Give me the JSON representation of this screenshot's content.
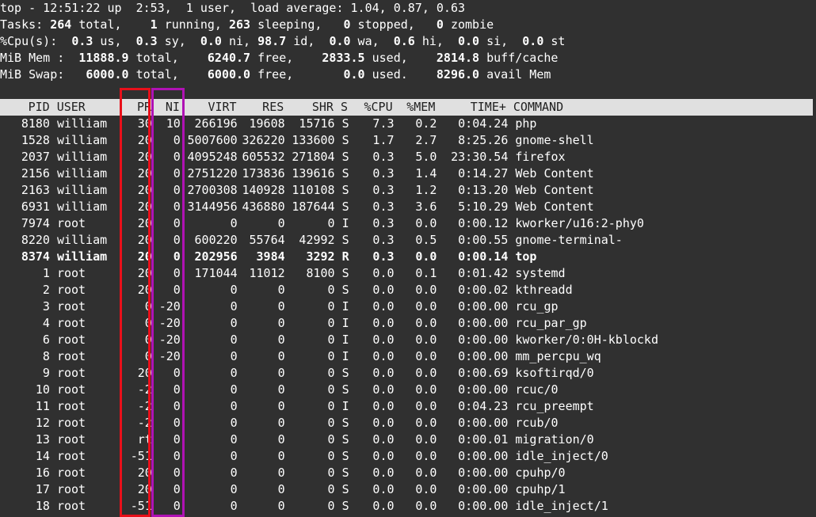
{
  "summary": {
    "line1": "top - 12:51:22 up  2:53,  1 user,  load average: 1.04, 0.87, 0.63",
    "tasks": {
      "label": "Tasks:",
      "total": "264",
      "total_l": " total,",
      "running": "1",
      "running_l": " running,",
      "sleeping": "263",
      "sleeping_l": " sleeping,",
      "stopped": "0",
      "stopped_l": " stopped,",
      "zombie": "0",
      "zombie_l": " zombie"
    },
    "cpu": {
      "label": "%Cpu(s):",
      "us": "0.3",
      "us_l": " us,",
      "sy": "0.3",
      "sy_l": " sy,",
      "ni": "0.0",
      "ni_l": " ni,",
      "id": "98.7",
      "id_l": " id,",
      "wa": "0.0",
      "wa_l": " wa,",
      "hi": "0.6",
      "hi_l": " hi,",
      "si": "0.0",
      "si_l": " si,",
      "st": "0.0",
      "st_l": " st"
    },
    "mem": {
      "label": "MiB Mem :",
      "total": "11888.9",
      "total_l": " total,",
      "free": "6240.7",
      "free_l": " free,",
      "used": "2833.5",
      "used_l": " used,",
      "buff": "2814.8",
      "buff_l": " buff/cache"
    },
    "swap": {
      "label": "MiB Swap:",
      "total": "6000.0",
      "total_l": " total,",
      "free": "6000.0",
      "free_l": " free,",
      "used": "0.0",
      "used_l": " used.",
      "avail": "8296.0",
      "avail_l": " avail Mem"
    }
  },
  "columns": [
    "PID",
    "USER",
    "PR",
    "NI",
    "VIRT",
    "RES",
    "SHR",
    "S",
    "%CPU",
    "%MEM",
    "TIME+",
    "COMMAND"
  ],
  "processes": [
    {
      "pid": "8180",
      "user": "william",
      "pr": "30",
      "ni": "10",
      "virt": "266196",
      "res": "19608",
      "shr": "15716",
      "s": "S",
      "cpu": "7.3",
      "mem": "0.2",
      "time": "0:04.24",
      "cmd": "php",
      "bold": false
    },
    {
      "pid": "1528",
      "user": "william",
      "pr": "20",
      "ni": "0",
      "virt": "5007600",
      "res": "326220",
      "shr": "133600",
      "s": "S",
      "cpu": "1.7",
      "mem": "2.7",
      "time": "8:25.26",
      "cmd": "gnome-shell",
      "bold": false
    },
    {
      "pid": "2037",
      "user": "william",
      "pr": "20",
      "ni": "0",
      "virt": "4095248",
      "res": "605532",
      "shr": "271804",
      "s": "S",
      "cpu": "0.3",
      "mem": "5.0",
      "time": "23:30.54",
      "cmd": "firefox",
      "bold": false
    },
    {
      "pid": "2156",
      "user": "william",
      "pr": "20",
      "ni": "0",
      "virt": "2751220",
      "res": "173836",
      "shr": "139616",
      "s": "S",
      "cpu": "0.3",
      "mem": "1.4",
      "time": "0:14.27",
      "cmd": "Web Content",
      "bold": false
    },
    {
      "pid": "2163",
      "user": "william",
      "pr": "20",
      "ni": "0",
      "virt": "2700308",
      "res": "140928",
      "shr": "110108",
      "s": "S",
      "cpu": "0.3",
      "mem": "1.2",
      "time": "0:13.20",
      "cmd": "Web Content",
      "bold": false
    },
    {
      "pid": "6931",
      "user": "william",
      "pr": "20",
      "ni": "0",
      "virt": "3144956",
      "res": "436880",
      "shr": "187644",
      "s": "S",
      "cpu": "0.3",
      "mem": "3.6",
      "time": "5:10.29",
      "cmd": "Web Content",
      "bold": false
    },
    {
      "pid": "7974",
      "user": "root",
      "pr": "20",
      "ni": "0",
      "virt": "0",
      "res": "0",
      "shr": "0",
      "s": "I",
      "cpu": "0.3",
      "mem": "0.0",
      "time": "0:00.12",
      "cmd": "kworker/u16:2-phy0",
      "bold": false
    },
    {
      "pid": "8220",
      "user": "william",
      "pr": "20",
      "ni": "0",
      "virt": "600220",
      "res": "55764",
      "shr": "42992",
      "s": "S",
      "cpu": "0.3",
      "mem": "0.5",
      "time": "0:00.55",
      "cmd": "gnome-terminal-",
      "bold": false
    },
    {
      "pid": "8374",
      "user": "william",
      "pr": "20",
      "ni": "0",
      "virt": "202956",
      "res": "3984",
      "shr": "3292",
      "s": "R",
      "cpu": "0.3",
      "mem": "0.0",
      "time": "0:00.14",
      "cmd": "top",
      "bold": true
    },
    {
      "pid": "1",
      "user": "root",
      "pr": "20",
      "ni": "0",
      "virt": "171044",
      "res": "11012",
      "shr": "8100",
      "s": "S",
      "cpu": "0.0",
      "mem": "0.1",
      "time": "0:01.42",
      "cmd": "systemd",
      "bold": false
    },
    {
      "pid": "2",
      "user": "root",
      "pr": "20",
      "ni": "0",
      "virt": "0",
      "res": "0",
      "shr": "0",
      "s": "S",
      "cpu": "0.0",
      "mem": "0.0",
      "time": "0:00.02",
      "cmd": "kthreadd",
      "bold": false
    },
    {
      "pid": "3",
      "user": "root",
      "pr": "0",
      "ni": "-20",
      "virt": "0",
      "res": "0",
      "shr": "0",
      "s": "I",
      "cpu": "0.0",
      "mem": "0.0",
      "time": "0:00.00",
      "cmd": "rcu_gp",
      "bold": false
    },
    {
      "pid": "4",
      "user": "root",
      "pr": "0",
      "ni": "-20",
      "virt": "0",
      "res": "0",
      "shr": "0",
      "s": "I",
      "cpu": "0.0",
      "mem": "0.0",
      "time": "0:00.00",
      "cmd": "rcu_par_gp",
      "bold": false
    },
    {
      "pid": "6",
      "user": "root",
      "pr": "0",
      "ni": "-20",
      "virt": "0",
      "res": "0",
      "shr": "0",
      "s": "I",
      "cpu": "0.0",
      "mem": "0.0",
      "time": "0:00.00",
      "cmd": "kworker/0:0H-kblockd",
      "bold": false
    },
    {
      "pid": "8",
      "user": "root",
      "pr": "0",
      "ni": "-20",
      "virt": "0",
      "res": "0",
      "shr": "0",
      "s": "I",
      "cpu": "0.0",
      "mem": "0.0",
      "time": "0:00.00",
      "cmd": "mm_percpu_wq",
      "bold": false
    },
    {
      "pid": "9",
      "user": "root",
      "pr": "20",
      "ni": "0",
      "virt": "0",
      "res": "0",
      "shr": "0",
      "s": "S",
      "cpu": "0.0",
      "mem": "0.0",
      "time": "0:00.69",
      "cmd": "ksoftirqd/0",
      "bold": false
    },
    {
      "pid": "10",
      "user": "root",
      "pr": "-2",
      "ni": "0",
      "virt": "0",
      "res": "0",
      "shr": "0",
      "s": "S",
      "cpu": "0.0",
      "mem": "0.0",
      "time": "0:00.00",
      "cmd": "rcuc/0",
      "bold": false
    },
    {
      "pid": "11",
      "user": "root",
      "pr": "-2",
      "ni": "0",
      "virt": "0",
      "res": "0",
      "shr": "0",
      "s": "I",
      "cpu": "0.0",
      "mem": "0.0",
      "time": "0:04.23",
      "cmd": "rcu_preempt",
      "bold": false
    },
    {
      "pid": "12",
      "user": "root",
      "pr": "-2",
      "ni": "0",
      "virt": "0",
      "res": "0",
      "shr": "0",
      "s": "S",
      "cpu": "0.0",
      "mem": "0.0",
      "time": "0:00.00",
      "cmd": "rcub/0",
      "bold": false
    },
    {
      "pid": "13",
      "user": "root",
      "pr": "rt",
      "ni": "0",
      "virt": "0",
      "res": "0",
      "shr": "0",
      "s": "S",
      "cpu": "0.0",
      "mem": "0.0",
      "time": "0:00.01",
      "cmd": "migration/0",
      "bold": false
    },
    {
      "pid": "14",
      "user": "root",
      "pr": "-51",
      "ni": "0",
      "virt": "0",
      "res": "0",
      "shr": "0",
      "s": "S",
      "cpu": "0.0",
      "mem": "0.0",
      "time": "0:00.00",
      "cmd": "idle_inject/0",
      "bold": false
    },
    {
      "pid": "16",
      "user": "root",
      "pr": "20",
      "ni": "0",
      "virt": "0",
      "res": "0",
      "shr": "0",
      "s": "S",
      "cpu": "0.0",
      "mem": "0.0",
      "time": "0:00.00",
      "cmd": "cpuhp/0",
      "bold": false
    },
    {
      "pid": "17",
      "user": "root",
      "pr": "20",
      "ni": "0",
      "virt": "0",
      "res": "0",
      "shr": "0",
      "s": "S",
      "cpu": "0.0",
      "mem": "0.0",
      "time": "0:00.00",
      "cmd": "cpuhp/1",
      "bold": false
    },
    {
      "pid": "18",
      "user": "root",
      "pr": "-51",
      "ni": "0",
      "virt": "0",
      "res": "0",
      "shr": "0",
      "s": "S",
      "cpu": "0.0",
      "mem": "0.0",
      "time": "0:00.00",
      "cmd": "idle_inject/1",
      "bold": false
    }
  ],
  "colors": {
    "background": "#303030",
    "text": "#ffffff",
    "header_bg": "#e0e0e0",
    "header_text": "#202020",
    "pr_highlight": "#e8101a",
    "ni_highlight": "#b012b4"
  }
}
